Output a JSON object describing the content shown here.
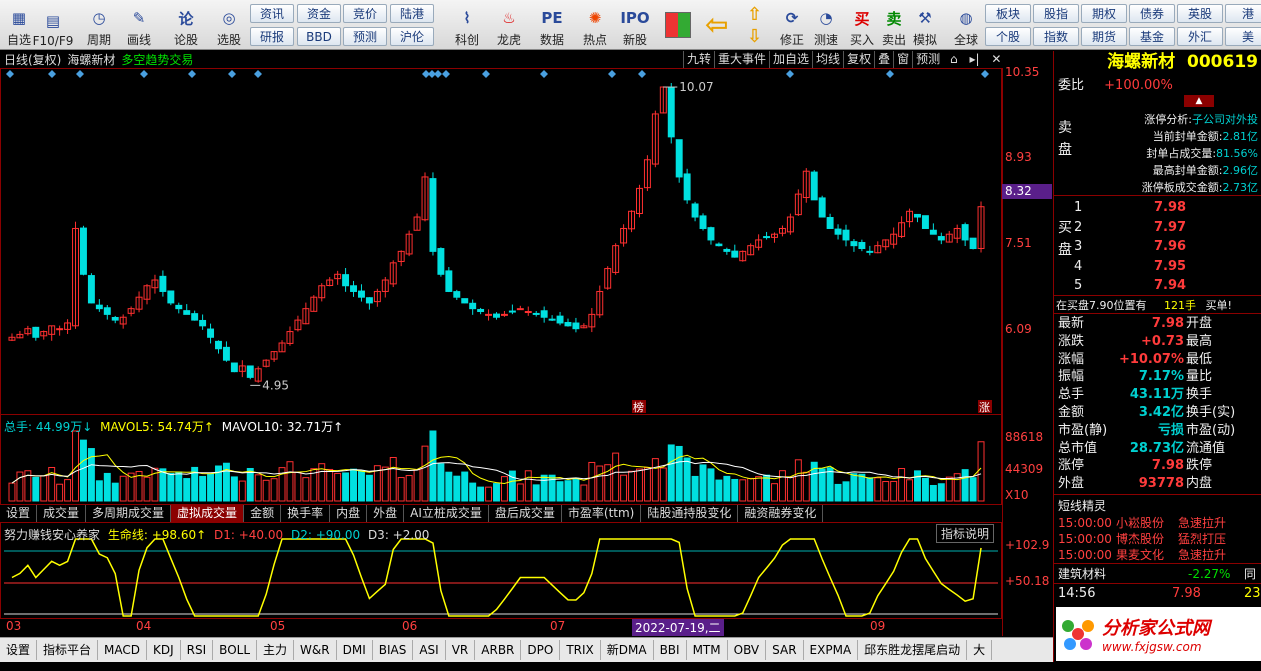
{
  "toolbar": {
    "buttons": [
      {
        "label": "自选",
        "icon": "list-icon",
        "x": 0
      },
      {
        "label": "F10/F9",
        "icon": "f10-icon",
        "x": 34
      },
      {
        "label": "周期",
        "icon": "clock-icon",
        "x": 80
      },
      {
        "label": "画线",
        "icon": "pencil-icon",
        "x": 120
      },
      {
        "label": "论股",
        "icon": "discuss-icon",
        "x": 167
      },
      {
        "label": "选股",
        "icon": "select-icon",
        "x": 210
      },
      {
        "label": "科创",
        "icon": "kechuang-icon",
        "x": 448
      },
      {
        "label": "龙虎",
        "icon": "dragon-icon",
        "x": 490
      },
      {
        "label": "数据",
        "icon": "data-icon",
        "x": 533
      },
      {
        "label": "热点",
        "icon": "hot-icon",
        "x": 576
      },
      {
        "label": "新股",
        "icon": "ipo-icon",
        "x": 616
      },
      {
        "label": "修正",
        "icon": "revise-icon",
        "x": 773
      },
      {
        "label": "测速",
        "icon": "speed-icon",
        "x": 807
      },
      {
        "label": "买入",
        "icon": "buy-icon",
        "x": 843
      },
      {
        "label": "卖出",
        "icon": "sell-icon",
        "x": 875
      },
      {
        "label": "模拟",
        "icon": "hammer-icon",
        "x": 906
      },
      {
        "label": "全球",
        "icon": "globe-icon",
        "x": 947
      }
    ],
    "small": [
      [
        "资讯",
        "资金",
        "竞价",
        "陆港"
      ],
      [
        "研报",
        "BBD",
        "预测",
        "沪伦"
      ],
      [
        "板块",
        "股指",
        "期权",
        "债券",
        "英股",
        "港"
      ],
      [
        "个股",
        "指数",
        "期货",
        "基金",
        "外汇",
        "美"
      ]
    ]
  },
  "chart_header": {
    "period": "日线(复权)",
    "name": "海螺新材",
    "indicator": "多空趋势交易"
  },
  "chart_menu": [
    "九转",
    "重大事件",
    "加自选",
    "均线",
    "复权",
    "叠",
    "窗",
    "预测"
  ],
  "stock": {
    "name": "海螺新材",
    "code": "000619"
  },
  "price_axis": [
    "10.35",
    "8.93",
    "8.32",
    "7.51",
    "6.09"
  ],
  "volume_axis": [
    "88618",
    "44309",
    "X10"
  ],
  "osc_axis": [
    "+102.9",
    "+50.18"
  ],
  "annotations": {
    "high": "10.07",
    "low": "4.95",
    "bang": "榜",
    "zhang": "涨"
  },
  "volume_info": {
    "total": "总手: 44.99万↓",
    "ma5": "MAVOL5: 54.74万↑",
    "ma10": "MAVOL10: 32.71万↑"
  },
  "osc_info": {
    "name": "努力赚钱安心养家",
    "line": "生命线: +98.60↑",
    "d1": "D1: +40.00",
    "d2": "D2: +90.00",
    "d3": "D3: +2.00",
    "explain": "指标说明"
  },
  "tabs": [
    "设置",
    "成交量",
    "多周期成交量",
    "虚拟成交量",
    "金额",
    "换手率",
    "内盘",
    "外盘",
    "AI立桩成交量",
    "盘后成交量",
    "市盈率(ttm)",
    "陆股通持股变化",
    "融资融券变化"
  ],
  "dates": [
    {
      "t": "03",
      "x": 6
    },
    {
      "t": "04",
      "x": 136
    },
    {
      "t": "05",
      "x": 270
    },
    {
      "t": "06",
      "x": 402
    },
    {
      "t": "07",
      "x": 550
    },
    {
      "t": "2022-07-19,二",
      "x": 632
    },
    {
      "t": "09",
      "x": 870
    }
  ],
  "bottom_tabs": [
    "设置",
    "指标平台",
    "MACD",
    "KDJ",
    "RSI",
    "BOLL",
    "主力",
    "W&R",
    "DMI",
    "BIAS",
    "ASI",
    "VR",
    "ARBR",
    "DPO",
    "TRIX",
    "新DMA",
    "BBI",
    "MTM",
    "OBV",
    "SAR",
    "EXPMA",
    "邱东胜龙摆尾启动",
    "大"
  ],
  "quote": {
    "weibi_label": "委比",
    "weibi": "+100.00%",
    "sell_label": "卖盘",
    "buy_label": "买盘",
    "limit": [
      [
        "涨停分析:",
        "子公司对外投"
      ],
      [
        "当前封单金额:",
        "2.81亿"
      ],
      [
        "封单占成交量:",
        "81.56%"
      ],
      [
        "最高封单金额:",
        "2.96亿"
      ],
      [
        "涨停板成交金额:",
        "2.73亿"
      ]
    ],
    "bids": [
      [
        "1",
        "7.98"
      ],
      [
        "2",
        "7.97"
      ],
      [
        "3",
        "7.96"
      ],
      [
        "4",
        "7.95"
      ],
      [
        "5",
        "7.94"
      ]
    ],
    "buy_note": "在买盘7.90位置有",
    "buy_hands": "121手",
    "buy_tag": "买单!",
    "stats": [
      [
        "最新",
        "7.98",
        "开盘",
        ""
      ],
      [
        "涨跌",
        "+0.73",
        "最高",
        ""
      ],
      [
        "涨幅",
        "+10.07%",
        "最低",
        ""
      ],
      [
        "振幅",
        "7.17%",
        "量比",
        ""
      ],
      [
        "总手",
        "43.11万",
        "换手",
        ""
      ],
      [
        "金额",
        "3.42亿",
        "换手(实)",
        ""
      ],
      [
        "市盈(静)",
        "亏损",
        "市盈(动)",
        ""
      ],
      [
        "总市值",
        "28.73亿",
        "流通值",
        ""
      ],
      [
        "涨停",
        "7.98",
        "跌停",
        ""
      ],
      [
        "外盘",
        "93778",
        "内盘",
        ""
      ]
    ],
    "elf_title": "短线精灵",
    "elf": [
      [
        "15:00:00",
        "小崧股份",
        "急速拉升"
      ],
      [
        "15:00:00",
        "博杰股份",
        "猛烈打压"
      ],
      [
        "15:00:00",
        "果麦文化",
        "急速拉升"
      ]
    ],
    "sector": "建筑材料",
    "sector_chg": "-2.27%",
    "sector_extra": "同",
    "tick_time": "14:56",
    "tick_price": "7.98",
    "tick_vol": "23",
    "logo": "分析家公式网",
    "site": "www.fxjgsw.com"
  },
  "chart_data": {
    "type": "candlestick",
    "ylim": [
      4.5,
      10.35
    ],
    "closes": [
      5.7,
      5.75,
      5.85,
      5.7,
      5.8,
      5.9,
      5.85,
      5.95,
      7.6,
      6.8,
      6.3,
      6.2,
      6.1,
      6.0,
      6.05,
      6.2,
      6.4,
      6.6,
      6.7,
      6.5,
      6.3,
      6.2,
      6.1,
      6.0,
      5.9,
      5.7,
      5.5,
      5.3,
      5.1,
      5.2,
      5.0,
      5.15,
      5.3,
      5.45,
      5.6,
      5.8,
      6.0,
      6.2,
      6.4,
      6.6,
      6.7,
      6.8,
      6.6,
      6.5,
      6.4,
      6.3,
      6.5,
      6.7,
      7.0,
      7.2,
      7.5,
      7.8,
      8.5,
      7.2,
      6.8,
      6.5,
      6.4,
      6.3,
      6.2,
      6.15,
      6.1,
      6.05,
      6.1,
      6.15,
      6.2,
      6.15,
      6.1,
      6.05,
      6.0,
      5.95,
      5.9,
      5.85,
      5.9,
      6.1,
      6.5,
      6.9,
      7.3,
      7.6,
      7.9,
      8.3,
      8.8,
      9.6,
      10.07,
      9.2,
      8.5,
      8.1,
      7.8,
      7.6,
      7.4,
      7.3,
      7.2,
      7.1,
      7.2,
      7.3,
      7.4,
      7.45,
      7.5,
      7.6,
      7.8,
      8.2,
      8.6,
      8.1,
      7.8,
      7.6,
      7.5,
      7.4,
      7.3,
      7.25,
      7.2,
      7.3,
      7.4,
      7.5,
      7.7,
      7.9,
      7.8,
      7.6,
      7.5,
      7.4,
      7.5,
      7.6,
      7.4,
      7.25,
      7.98
    ],
    "volume_max": 88618
  }
}
